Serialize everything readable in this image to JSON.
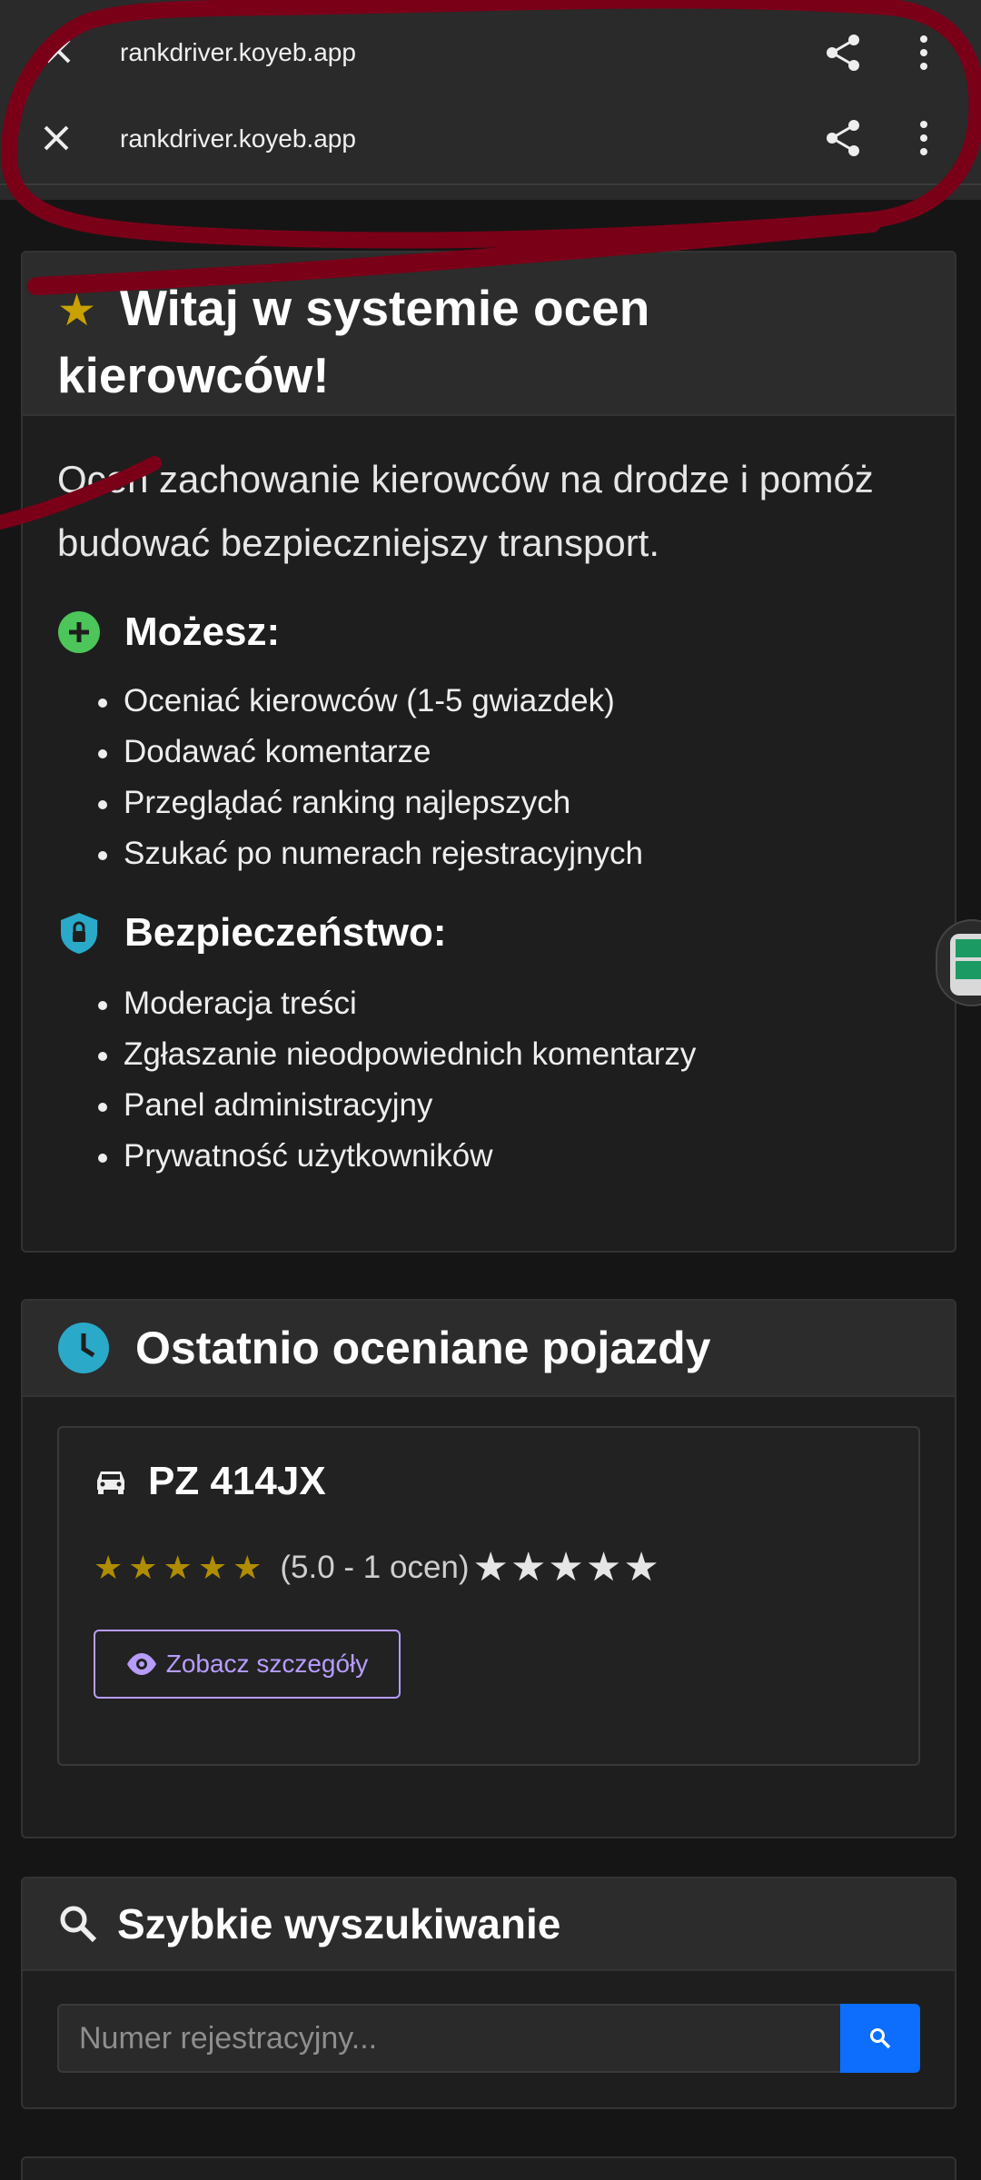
{
  "browser": {
    "url_top": "rankdriver.koyeb.app",
    "url_main": "rankdriver.koyeb.app"
  },
  "welcome": {
    "title": "Witaj w systemie ocen kierowców!",
    "intro": "Oceń zachowanie kierowców na drodze i pomóż budować bezpieczniejszy transport.",
    "can_title": "Możesz:",
    "can_items": [
      "Oceniać kierowców (1-5 gwiazdek)",
      "Dodawać komentarze",
      "Przeglądać ranking najlepszych",
      "Szukać po numerach rejestracyjnych"
    ],
    "security_title": "Bezpieczeństwo:",
    "security_items": [
      "Moderacja treści",
      "Zgłaszanie nieodpowiednich komentarzy",
      "Panel administracyjny",
      "Prywatność użytkowników"
    ]
  },
  "recent": {
    "title": "Ostatnio oceniane pojazdy",
    "vehicle": {
      "plate": "PZ 414JX",
      "rating_text": "(5.0 - 1 ocen)",
      "rating_value": 5,
      "rating_max": 5,
      "details_label": "Zobacz szczegóły"
    }
  },
  "quick_search": {
    "title": "Szybkie wyszukiwanie",
    "placeholder": "Numer rejestracyjny..."
  },
  "colors": {
    "accent_blue": "#0d6efd",
    "gold_star": "#b08c00",
    "details_purple": "#b79cff",
    "green_icon": "#4cc55a",
    "teal_icon": "#2aa9c9"
  }
}
